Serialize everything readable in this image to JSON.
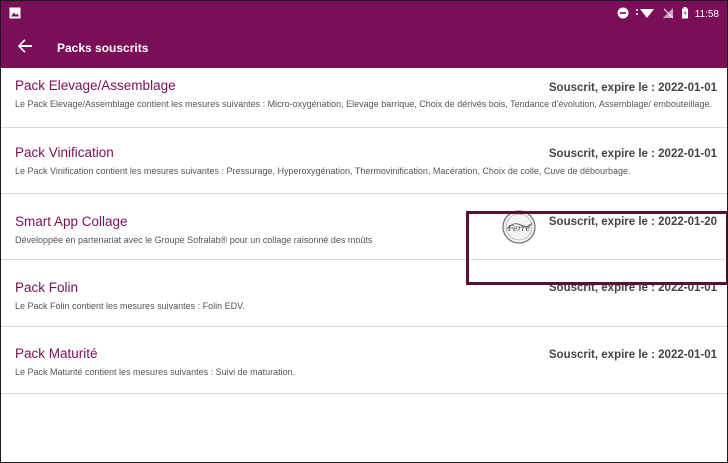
{
  "status_bar": {
    "time": "11:58",
    "icons": [
      "image-icon",
      "minus-circle-icon",
      "wifi-icon",
      "no-sim-icon",
      "battery-icon"
    ]
  },
  "app_bar": {
    "back_icon": "arrow-left-icon",
    "title": "Packs souscrits"
  },
  "colors": {
    "primary": "#7a0f57",
    "highlight_border": "#5a1036"
  },
  "packs": [
    {
      "title": "Pack Elevage/Assemblage",
      "status": "Souscrit, expire le : 2022-01-01",
      "description": "Le Pack Elevage/Assemblage contient les mesures suivantes : Micro-oxygénation, Elevage barrique, Choix de dérivés bois, Tendance d'évolution, Assemblage/ embouteillage."
    },
    {
      "title": "Pack Vinification",
      "status": "Souscrit, expire le : 2022-01-01",
      "description": "Le Pack Vinification contient les mesures suivantes : Pressurage, Hyperoxygénation, Thermovinification, Macération, Choix de colle, Cuve de débourbage."
    },
    {
      "title": "Smart App Collage",
      "status": "Souscrit, expire le : 2022-01-20",
      "description": "Développée en partenariat avec le Groupe Sofralab® pour un collage raisonné des moûts",
      "logo_text": "Ferré"
    },
    {
      "title": "Pack Folin",
      "status": "Souscrit, expire le : 2022-01-01",
      "description": "Le Pack Folin contient les mesures suivantes : Folin EDV."
    },
    {
      "title": "Pack Maturité",
      "status": "Souscrit, expire le : 2022-01-01",
      "description": "Le Pack Maturité contient les mesures suivantes : Suivi de maturation."
    }
  ]
}
